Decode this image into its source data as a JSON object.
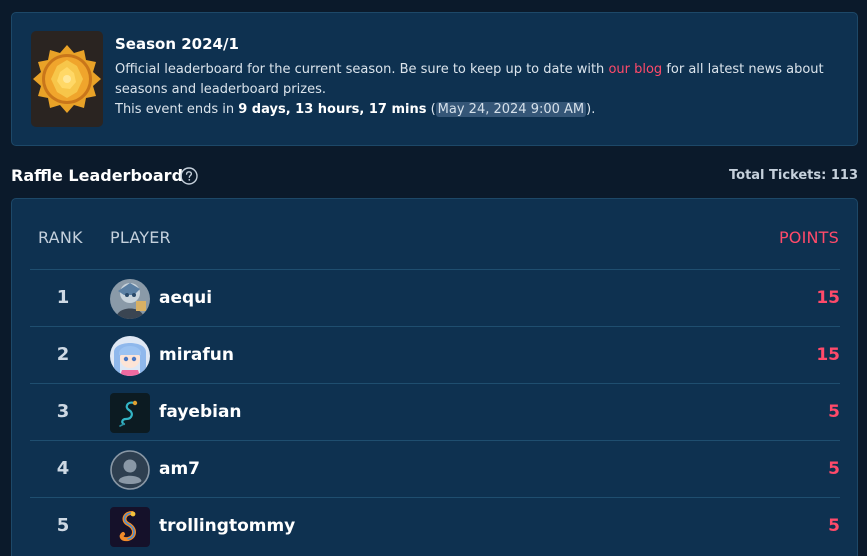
{
  "season": {
    "title": "Season 2024/1",
    "desc_before_link": "Official leaderboard for the current season. Be sure to keep up to date with ",
    "link_text": "our blog",
    "desc_after_link": " for all latest news about seasons and leaderboard prizes.",
    "ends_prefix": "This event ends in ",
    "ends_countdown": "9 days, 13 hours, 17 mins",
    "ends_open": " (",
    "ends_date": "May 24, 2024 9:00 AM",
    "ends_close": ").",
    "badge_icon": "sun-badge-icon"
  },
  "leaderboard": {
    "title": "Raffle Leaderboard",
    "help_icon": "question-circle-icon",
    "total_tickets": "Total Tickets: 113",
    "columns": {
      "rank": "RANK",
      "player": "PLAYER",
      "points": "POINTS"
    },
    "rows": [
      {
        "rank": "1",
        "player": "aequi",
        "points": "15",
        "avatar": "aequi-avatar"
      },
      {
        "rank": "2",
        "player": "mirafun",
        "points": "15",
        "avatar": "mirafun-avatar"
      },
      {
        "rank": "3",
        "player": "fayebian",
        "points": "5",
        "avatar": "fayebian-avatar"
      },
      {
        "rank": "4",
        "player": "am7",
        "points": "5",
        "avatar": "default-user-avatar"
      },
      {
        "rank": "5",
        "player": "trollingtommy",
        "points": "5",
        "avatar": "trollingtommy-avatar"
      }
    ]
  },
  "colors": {
    "accent": "#ff4a6a",
    "card_bg": "#0e3150",
    "page_bg": "#0b1a2b"
  }
}
